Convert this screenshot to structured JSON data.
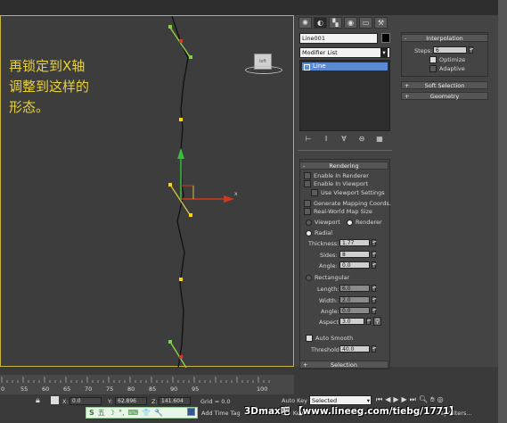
{
  "note": {
    "text": "再锁定到X轴\n调整到这样的\n形态。"
  },
  "viewcube": {
    "label": "left"
  },
  "command_panel": {
    "tabs": [
      "create-icon",
      "modify-icon",
      "hierarchy-icon",
      "motion-icon",
      "display-icon",
      "utilities-icon"
    ],
    "object_name": "Line001",
    "object_color": "#000000",
    "modifier_list": "Modifier List",
    "stack_item": "Line",
    "stack_controls": [
      "pin-stack-icon",
      "show-end-result-icon",
      "make-unique-icon",
      "remove-modifier-icon",
      "configure-sets-icon"
    ]
  },
  "interpolation": {
    "title": "Interpolation",
    "steps_label": "Steps:",
    "steps_value": "6",
    "optimize_label": "Optimize",
    "optimize_checked": true,
    "adaptive_label": "Adaptive",
    "adaptive_checked": false
  },
  "soft_selection": {
    "title": "Soft Selection"
  },
  "geometry": {
    "title": "Geometry"
  },
  "rendering": {
    "title": "Rendering",
    "enable_renderer": "Enable In Renderer",
    "enable_viewport": "Enable In Viewport",
    "use_viewport_settings": "Use Viewport Settings",
    "generate_mapping": "Generate Mapping Coords.",
    "real_world_map": "Real-World Map Size",
    "viewport_label": "Viewport",
    "renderer_label": "Renderer",
    "radial_label": "Radial",
    "thickness_label": "Thickness:",
    "thickness_value": "1.77",
    "sides_label": "Sides:",
    "sides_value": "8",
    "angle_label": "Angle:",
    "angle_value": "0.0",
    "rectangular_label": "Rectangular",
    "length_label": "Length:",
    "length_value": "6.0",
    "width_label": "Width:",
    "width_value": "2.0",
    "angle2_label": "Angle:",
    "angle2_value": "0.0",
    "aspect_label": "Aspect:",
    "aspect_value": "3.0",
    "auto_smooth_label": "Auto Smooth",
    "auto_smooth_checked": true,
    "threshold_label": "Threshold:",
    "threshold_value": "40.0"
  },
  "selection": {
    "title": "Selection"
  },
  "timeline": {
    "ticks": [
      "0",
      "55",
      "60",
      "65",
      "70",
      "75",
      "80",
      "85",
      "90",
      "95",
      "100"
    ]
  },
  "status": {
    "x_label": "X:",
    "x_value": "0.0",
    "y_label": "Y:",
    "y_value": "62.896",
    "z_label": "Z:",
    "z_value": "141.604",
    "grid_text": "Grid = 0.0",
    "auto_key": "Auto Key",
    "selected": "Selected",
    "add_time_tag": "Add Time Tag",
    "set_key": "Set Key",
    "key_filters": "Key Filters..."
  },
  "ime": {
    "items": [
      "S",
      "五",
      "☽",
      "°,",
      "⌨",
      "👕",
      "🔧"
    ]
  },
  "watermark": {
    "text": "3Dmax吧 【www.lineeg.com/tiebg/1771】"
  },
  "colors": {
    "viewport_border": "#c9b23a",
    "note_text": "#e8d23a",
    "spline": "#111111",
    "vertex": "#ffd400",
    "handle": "#7cd63a",
    "axis_x": "#d03a1a",
    "axis_y": "#35c23a"
  }
}
